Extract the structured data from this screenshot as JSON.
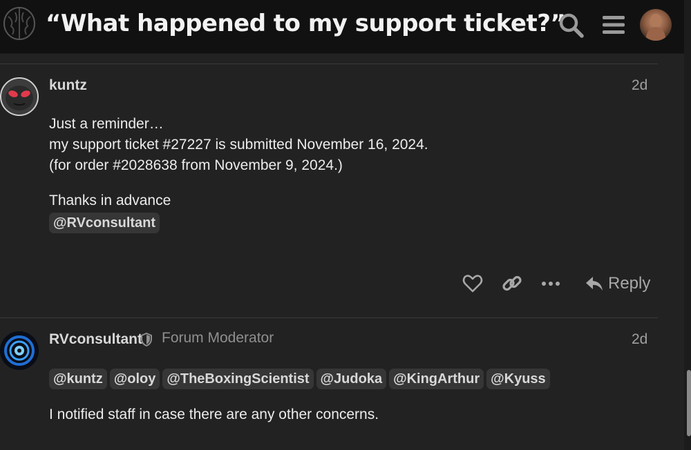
{
  "header": {
    "title": "“What happened to my support ticket?”",
    "logo_icon": "brain-logo-icon",
    "search_icon": "search-icon",
    "menu_icon": "hamburger-menu-icon",
    "avatar_icon": "user-avatar-icon"
  },
  "posts": [
    {
      "username": "kuntz",
      "age": "2d",
      "paragraphs": [
        "Just a reminder…",
        "my support ticket #27227 is submitted November 16, 2024.",
        "(for order #2028638 from November 9, 2024.)",
        "Thanks in advance"
      ],
      "mention": "@RVconsultant",
      "actions": {
        "like_icon": "heart-icon",
        "link_icon": "link-icon",
        "more_icon": "more-dots-icon",
        "reply_label": "Reply",
        "reply_icon": "reply-arrow-icon"
      }
    },
    {
      "username": "RVconsultant",
      "user_title": "Forum Moderator",
      "badge_icon": "moderator-shield-icon",
      "age": "2d",
      "mentions": [
        "@kuntz",
        "@oloy",
        "@TheBoxingScientist",
        "@Judoka",
        "@KingArthur",
        "@Kyuss"
      ],
      "text": "I notified staff in case there are any other concerns."
    }
  ],
  "colors": {
    "background": "#222222",
    "header_bg": "#111111",
    "text": "#ececec",
    "muted": "#a0a0a0",
    "mention_bg": "#363636"
  }
}
